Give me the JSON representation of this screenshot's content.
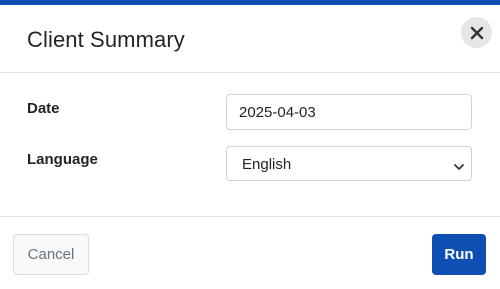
{
  "dialog": {
    "title": "Client Summary",
    "close_icon": "close-icon",
    "accent_color": "#0f4fb3"
  },
  "form": {
    "date": {
      "label": "Date",
      "value": "2025-04-03"
    },
    "language": {
      "label": "Language",
      "selected": "English",
      "chevron_icon": "chevron-down-icon"
    }
  },
  "footer": {
    "cancel_label": "Cancel",
    "run_label": "Run"
  }
}
